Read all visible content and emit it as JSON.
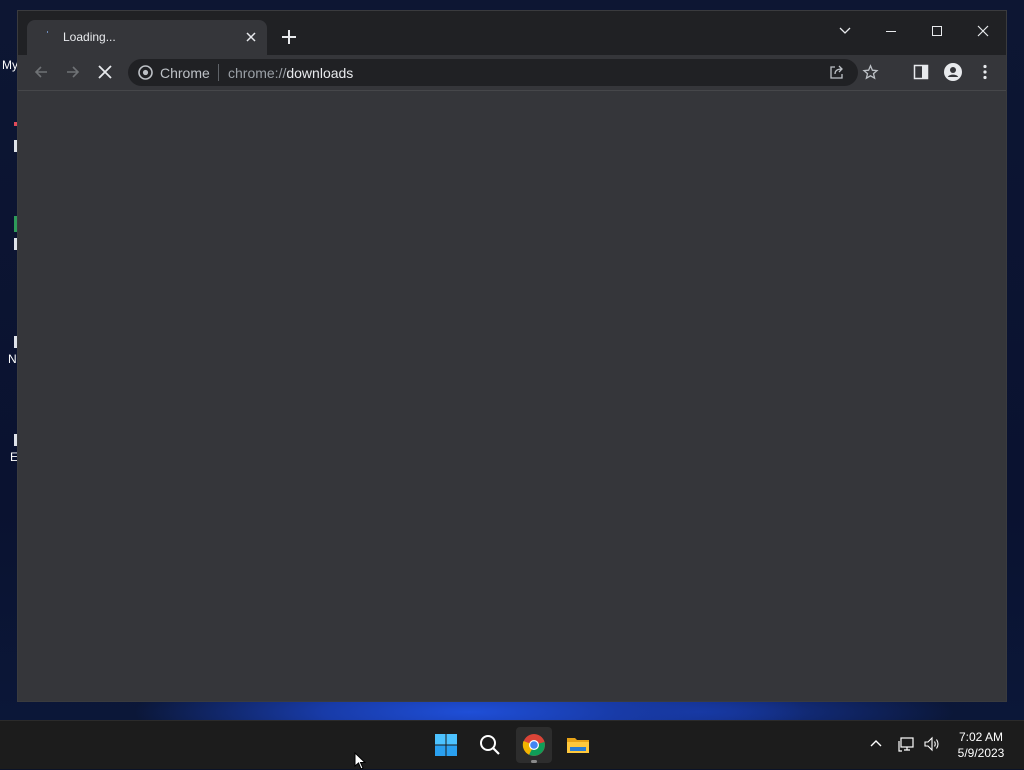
{
  "desktop": {
    "icons": [
      {
        "label": "My"
      },
      {
        "label": ""
      },
      {
        "label": ""
      },
      {
        "label": "N"
      },
      {
        "label": "E"
      }
    ]
  },
  "browser": {
    "tab": {
      "title": "Loading...",
      "close_icon": "close-icon"
    },
    "new_tab_icon": "plus-icon",
    "window_controls": [
      "tab-search-icon",
      "minimize-icon",
      "maximize-icon",
      "close-icon"
    ],
    "toolbar": {
      "back_icon": "back-arrow-icon",
      "forward_icon": "forward-arrow-icon",
      "stop_icon": "stop-icon",
      "omnibox": {
        "chip_label": "Chrome",
        "url_scheme": "chrome://",
        "url_host": "downloads",
        "share_icon": "share-icon",
        "bookmark_icon": "star-icon"
      },
      "side_panel_icon": "side-panel-icon",
      "profile_icon": "profile-icon",
      "menu_icon": "kebab-menu-icon"
    }
  },
  "taskbar": {
    "apps": [
      "windows-start-icon",
      "search-icon",
      "chrome-icon",
      "file-explorer-icon"
    ],
    "active_app": "chrome-icon",
    "tray": [
      "chevron-up-icon",
      "network-icon",
      "volume-icon"
    ],
    "clock": {
      "time": "7:02 AM",
      "date": "5/9/2023"
    }
  },
  "colors": {
    "tabstrip": "#202124",
    "toolbar": "#35363a",
    "omnibox": "#202124",
    "taskbar": "#1c1c1c"
  }
}
